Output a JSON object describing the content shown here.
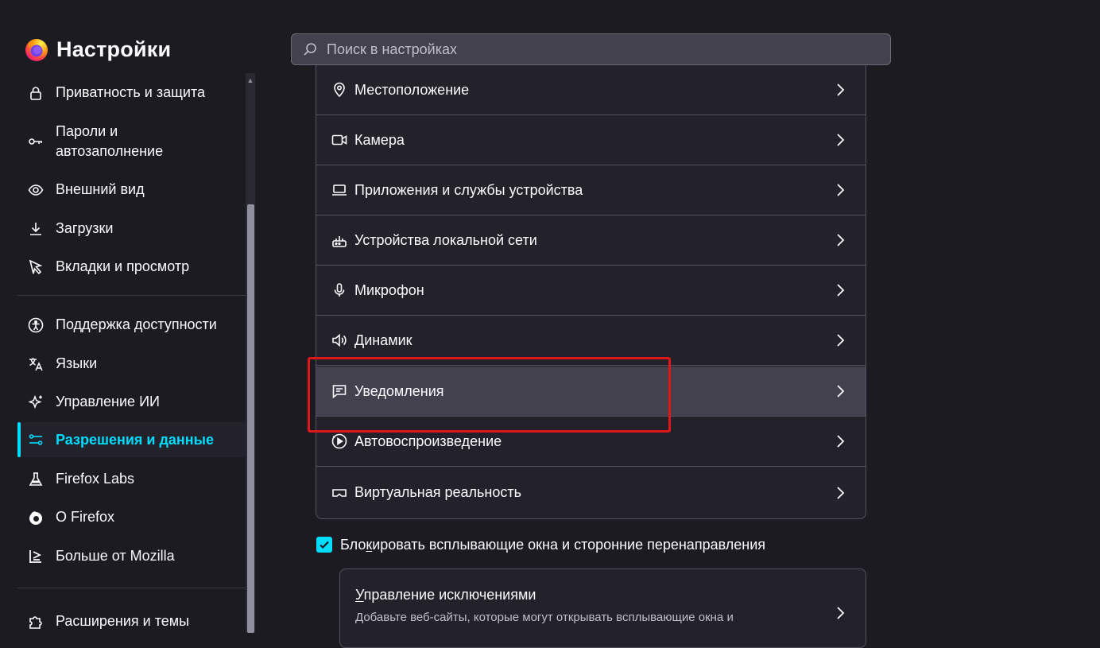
{
  "app": {
    "title": "Настройки",
    "search_placeholder": "Поиск в настройках"
  },
  "colors": {
    "accent": "#00ddff",
    "background": "#1c1b22",
    "highlight_box": "#e0161b"
  },
  "sidebar": {
    "items": [
      {
        "label": "Приватность и защита",
        "icon": "lock-icon"
      },
      {
        "label": "Пароли и",
        "label2": "автозаполнение",
        "icon": "key-icon"
      },
      {
        "label": "Внешний вид",
        "icon": "eye-icon"
      },
      {
        "label": "Загрузки",
        "icon": "download-icon"
      },
      {
        "label": "Вкладки и просмотр",
        "icon": "cursor-icon"
      },
      {
        "label": "Поддержка доступности",
        "icon": "accessibility-icon"
      },
      {
        "label": "Языки",
        "icon": "translate-icon"
      },
      {
        "label": "Управление ИИ",
        "icon": "sparkle-icon"
      },
      {
        "label": "Разрешения и данные",
        "icon": "sliders-icon",
        "active": true
      },
      {
        "label": "Firefox Labs",
        "icon": "flask-icon"
      },
      {
        "label": "О Firefox",
        "icon": "firefox-icon"
      },
      {
        "label": "Больше от Mozilla",
        "icon": "mozilla-icon"
      },
      {
        "label": "Расширения и темы",
        "icon": "puzzle-icon"
      }
    ]
  },
  "permissions": {
    "rows": [
      {
        "label": "Местоположение",
        "icon": "location-icon"
      },
      {
        "label": "Камера",
        "icon": "camera-icon"
      },
      {
        "label": "Приложения и службы устройства",
        "icon": "laptop-icon"
      },
      {
        "label": "Устройства локальной сети",
        "icon": "router-icon"
      },
      {
        "label": "Микрофон",
        "icon": "microphone-icon"
      },
      {
        "label": "Динамик",
        "icon": "speaker-icon"
      },
      {
        "label": "Уведомления",
        "icon": "notification-icon"
      },
      {
        "label": "Автовоспроизведение",
        "icon": "autoplay-icon"
      },
      {
        "label": "Виртуальная реальность",
        "icon": "vr-icon"
      }
    ]
  },
  "popups": {
    "checkbox_label_a": "Бло",
    "checkbox_label_u": "к",
    "checkbox_label_b": "ировать всплывающие окна и сторонние перенаправления",
    "checked": true,
    "exceptions_title_u": "У",
    "exceptions_title": "правление исключениями",
    "exceptions_desc": "Добавьте веб-сайты, которые могут открывать всплывающие окна и"
  }
}
